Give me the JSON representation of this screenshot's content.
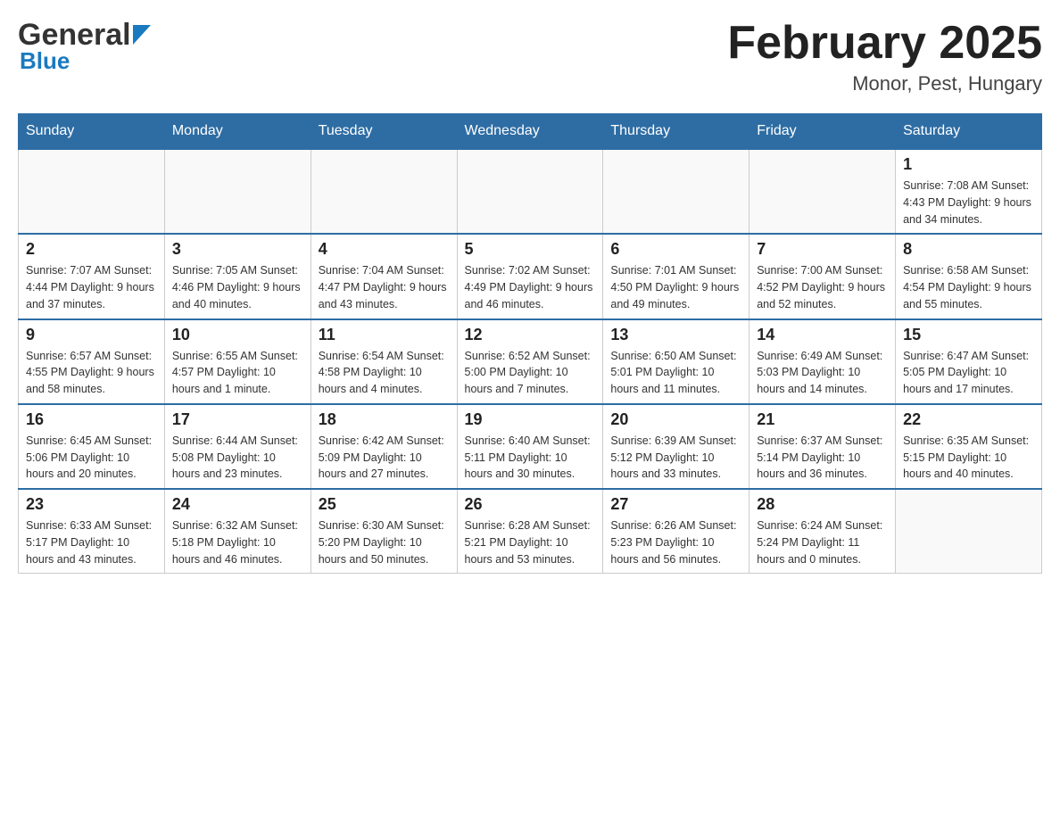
{
  "header": {
    "logo_general": "General",
    "logo_blue": "Blue",
    "month_title": "February 2025",
    "location": "Monor, Pest, Hungary"
  },
  "days_of_week": [
    "Sunday",
    "Monday",
    "Tuesday",
    "Wednesday",
    "Thursday",
    "Friday",
    "Saturday"
  ],
  "weeks": [
    [
      {
        "day": "",
        "info": ""
      },
      {
        "day": "",
        "info": ""
      },
      {
        "day": "",
        "info": ""
      },
      {
        "day": "",
        "info": ""
      },
      {
        "day": "",
        "info": ""
      },
      {
        "day": "",
        "info": ""
      },
      {
        "day": "1",
        "info": "Sunrise: 7:08 AM\nSunset: 4:43 PM\nDaylight: 9 hours\nand 34 minutes."
      }
    ],
    [
      {
        "day": "2",
        "info": "Sunrise: 7:07 AM\nSunset: 4:44 PM\nDaylight: 9 hours\nand 37 minutes."
      },
      {
        "day": "3",
        "info": "Sunrise: 7:05 AM\nSunset: 4:46 PM\nDaylight: 9 hours\nand 40 minutes."
      },
      {
        "day": "4",
        "info": "Sunrise: 7:04 AM\nSunset: 4:47 PM\nDaylight: 9 hours\nand 43 minutes."
      },
      {
        "day": "5",
        "info": "Sunrise: 7:02 AM\nSunset: 4:49 PM\nDaylight: 9 hours\nand 46 minutes."
      },
      {
        "day": "6",
        "info": "Sunrise: 7:01 AM\nSunset: 4:50 PM\nDaylight: 9 hours\nand 49 minutes."
      },
      {
        "day": "7",
        "info": "Sunrise: 7:00 AM\nSunset: 4:52 PM\nDaylight: 9 hours\nand 52 minutes."
      },
      {
        "day": "8",
        "info": "Sunrise: 6:58 AM\nSunset: 4:54 PM\nDaylight: 9 hours\nand 55 minutes."
      }
    ],
    [
      {
        "day": "9",
        "info": "Sunrise: 6:57 AM\nSunset: 4:55 PM\nDaylight: 9 hours\nand 58 minutes."
      },
      {
        "day": "10",
        "info": "Sunrise: 6:55 AM\nSunset: 4:57 PM\nDaylight: 10 hours\nand 1 minute."
      },
      {
        "day": "11",
        "info": "Sunrise: 6:54 AM\nSunset: 4:58 PM\nDaylight: 10 hours\nand 4 minutes."
      },
      {
        "day": "12",
        "info": "Sunrise: 6:52 AM\nSunset: 5:00 PM\nDaylight: 10 hours\nand 7 minutes."
      },
      {
        "day": "13",
        "info": "Sunrise: 6:50 AM\nSunset: 5:01 PM\nDaylight: 10 hours\nand 11 minutes."
      },
      {
        "day": "14",
        "info": "Sunrise: 6:49 AM\nSunset: 5:03 PM\nDaylight: 10 hours\nand 14 minutes."
      },
      {
        "day": "15",
        "info": "Sunrise: 6:47 AM\nSunset: 5:05 PM\nDaylight: 10 hours\nand 17 minutes."
      }
    ],
    [
      {
        "day": "16",
        "info": "Sunrise: 6:45 AM\nSunset: 5:06 PM\nDaylight: 10 hours\nand 20 minutes."
      },
      {
        "day": "17",
        "info": "Sunrise: 6:44 AM\nSunset: 5:08 PM\nDaylight: 10 hours\nand 23 minutes."
      },
      {
        "day": "18",
        "info": "Sunrise: 6:42 AM\nSunset: 5:09 PM\nDaylight: 10 hours\nand 27 minutes."
      },
      {
        "day": "19",
        "info": "Sunrise: 6:40 AM\nSunset: 5:11 PM\nDaylight: 10 hours\nand 30 minutes."
      },
      {
        "day": "20",
        "info": "Sunrise: 6:39 AM\nSunset: 5:12 PM\nDaylight: 10 hours\nand 33 minutes."
      },
      {
        "day": "21",
        "info": "Sunrise: 6:37 AM\nSunset: 5:14 PM\nDaylight: 10 hours\nand 36 minutes."
      },
      {
        "day": "22",
        "info": "Sunrise: 6:35 AM\nSunset: 5:15 PM\nDaylight: 10 hours\nand 40 minutes."
      }
    ],
    [
      {
        "day": "23",
        "info": "Sunrise: 6:33 AM\nSunset: 5:17 PM\nDaylight: 10 hours\nand 43 minutes."
      },
      {
        "day": "24",
        "info": "Sunrise: 6:32 AM\nSunset: 5:18 PM\nDaylight: 10 hours\nand 46 minutes."
      },
      {
        "day": "25",
        "info": "Sunrise: 6:30 AM\nSunset: 5:20 PM\nDaylight: 10 hours\nand 50 minutes."
      },
      {
        "day": "26",
        "info": "Sunrise: 6:28 AM\nSunset: 5:21 PM\nDaylight: 10 hours\nand 53 minutes."
      },
      {
        "day": "27",
        "info": "Sunrise: 6:26 AM\nSunset: 5:23 PM\nDaylight: 10 hours\nand 56 minutes."
      },
      {
        "day": "28",
        "info": "Sunrise: 6:24 AM\nSunset: 5:24 PM\nDaylight: 11 hours\nand 0 minutes."
      },
      {
        "day": "",
        "info": ""
      }
    ]
  ]
}
